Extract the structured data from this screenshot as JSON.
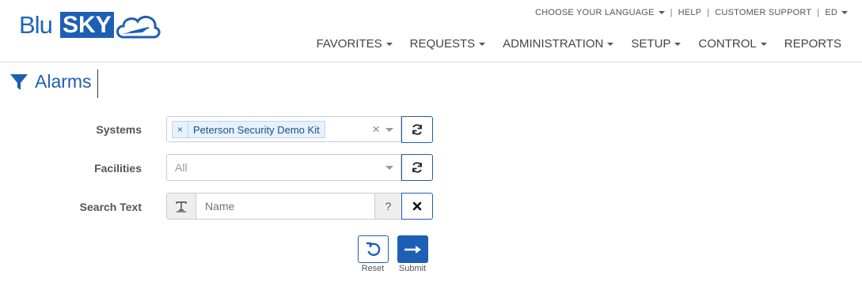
{
  "brand": {
    "part1": "Blu",
    "part2": "SKY"
  },
  "topbar": {
    "language_label": "CHOOSE YOUR LANGUAGE",
    "help_label": "HELP",
    "support_label": "CUSTOMER SUPPORT",
    "user_label": "ED"
  },
  "nav": {
    "favorites": "FAVORITES",
    "requests": "REQUESTS",
    "administration": "ADMINISTRATION",
    "setup": "SETUP",
    "control": "CONTROL",
    "reports": "REPORTS"
  },
  "page": {
    "title": "Alarms"
  },
  "form": {
    "systems_label": "Systems",
    "systems_selected": "Peterson Security Demo Kit",
    "systems_tag_remove": "×",
    "systems_clear": "×",
    "facilities_label": "Facilities",
    "facilities_placeholder": "All",
    "search_label": "Search Text",
    "search_placeholder": "Name",
    "search_help": "?"
  },
  "actions": {
    "reset_label": "Reset",
    "submit_label": "Submit"
  },
  "colors": {
    "primary": "#1d5fb4",
    "border": "#cccccc",
    "tag_bg": "#e6f1fc"
  }
}
